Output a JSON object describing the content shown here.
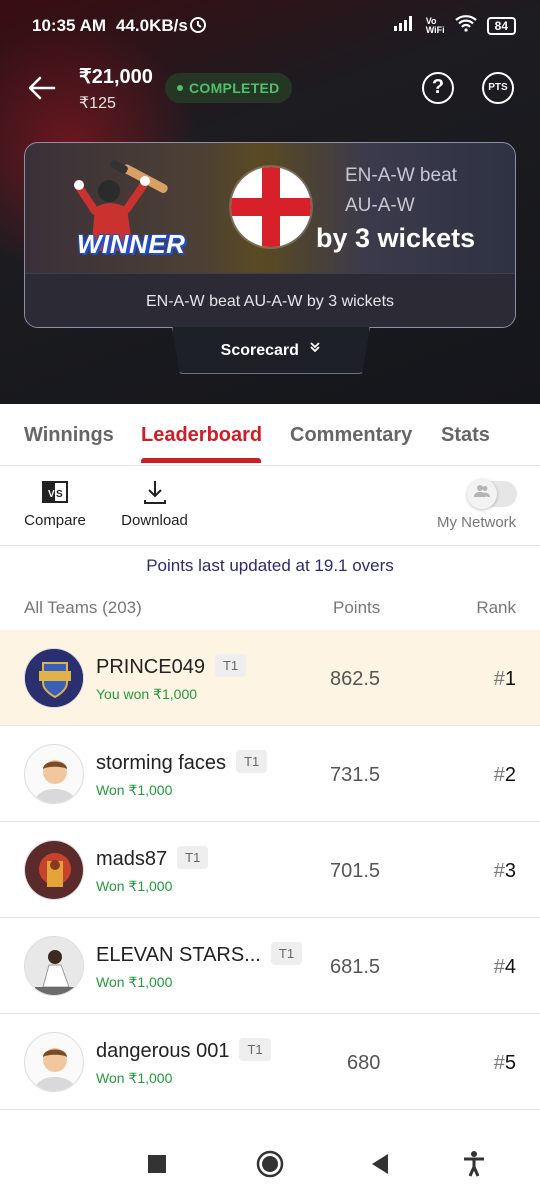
{
  "status_bar": {
    "time": "10:35 AM",
    "speed": "44.0KB/s",
    "battery": "84"
  },
  "header": {
    "prize": "₹21,000",
    "entry_fee": "₹125",
    "status_badge": "COMPLETED",
    "help_label": "?",
    "pts_label": "PTS"
  },
  "result_card": {
    "winner_label": "WINNER",
    "result_line1": "EN-A-W beat",
    "result_line2": "AU-A-W",
    "margin": "by 3 wickets",
    "summary": "EN-A-W beat AU-A-W by 3 wickets",
    "scorecard_label": "Scorecard"
  },
  "tabs": [
    {
      "label": "Winnings",
      "active": false
    },
    {
      "label": "Leaderboard",
      "active": true
    },
    {
      "label": "Commentary",
      "active": false
    },
    {
      "label": "Stats",
      "active": false
    }
  ],
  "tools": {
    "compare_label": "Compare",
    "download_label": "Download",
    "network_label": "My Network",
    "network_on": false
  },
  "leaderboard": {
    "updated_text": "Points last updated at 19.1 overs",
    "col_teams": "All Teams (203)",
    "col_points": "Points",
    "col_rank": "Rank",
    "rows": [
      {
        "name": "PRINCE049",
        "team": "T1",
        "won": "You won ₹1,000",
        "points": "862.5",
        "rank_hash": "#",
        "rank": "1"
      },
      {
        "name": "storming faces",
        "team": "T1",
        "won": "Won ₹1,000",
        "points": "731.5",
        "rank_hash": "#",
        "rank": "2"
      },
      {
        "name": "mads87",
        "team": "T1",
        "won": "Won ₹1,000",
        "points": "701.5",
        "rank_hash": "#",
        "rank": "3"
      },
      {
        "name": "ELEVAN STARS...",
        "team": "T1",
        "won": "Won ₹1,000",
        "points": "681.5",
        "rank_hash": "#",
        "rank": "4"
      },
      {
        "name": "dangerous 001",
        "team": "T1",
        "won": "Won ₹1,000",
        "points": "680",
        "rank_hash": "#",
        "rank": "5"
      }
    ]
  },
  "colors": {
    "accent": "#d21c25",
    "won_green": "#1f9e3a",
    "highlight_row": "#fdf4e3"
  }
}
